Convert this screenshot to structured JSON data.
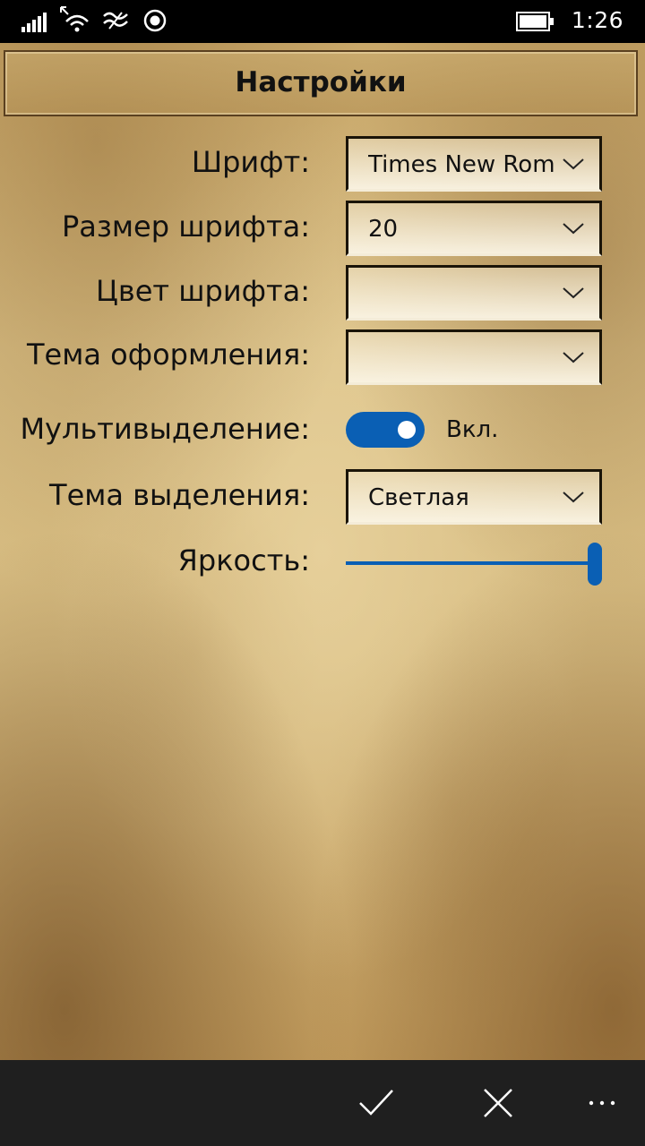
{
  "status_bar": {
    "time": "1:26",
    "icons": [
      "signal-icon",
      "wifi-icon",
      "hotspot-icon",
      "location-icon",
      "battery-icon"
    ]
  },
  "header": {
    "title": "Настройки"
  },
  "settings": {
    "font": {
      "label": "Шрифт:",
      "value": "Times New Roman"
    },
    "font_size": {
      "label": "Размер шрифта:",
      "value": "20"
    },
    "font_color": {
      "label": "Цвет шрифта:",
      "value": ""
    },
    "theme": {
      "label": "Тема оформления:",
      "value": ""
    },
    "multi_select": {
      "label": "Мультивыделение:",
      "state": "Вкл.",
      "on": true
    },
    "selection_theme": {
      "label": "Тема выделения:",
      "value": "Светлая"
    },
    "brightness": {
      "label": "Яркость:",
      "level": 1.0
    }
  },
  "app_bar": {
    "buttons": [
      "checkmark-icon",
      "close-icon",
      "more-icon"
    ]
  },
  "colors": {
    "accent": "#0a5fb4",
    "app_bar": "#1f1f1f"
  }
}
